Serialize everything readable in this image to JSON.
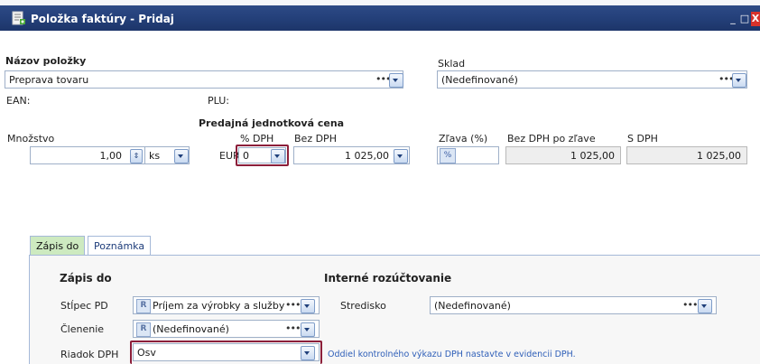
{
  "window": {
    "title": "Položka faktúry - Pridaj",
    "buttons": {
      "minimize": "_",
      "maximize": "□",
      "close": "X"
    }
  },
  "item_name": {
    "label": "Názov položky",
    "value": "Preprava tovaru"
  },
  "warehouse": {
    "label": "Sklad",
    "value": "(Nedefinované)"
  },
  "ean_label": "EAN:",
  "plu_label": "PLU:",
  "unit_price_heading": "Predajná jednotková cena",
  "quantity": {
    "label": "Množstvo",
    "value": "1,00",
    "unit": "ks"
  },
  "currency": "EUR",
  "vat_percent": {
    "label": "% DPH",
    "value": "0"
  },
  "price_excl_vat": {
    "label": "Bez DPH",
    "value": "1 025,00"
  },
  "discount": {
    "label": "Zľava (%)",
    "button": "%"
  },
  "price_after_discount": {
    "label": "Bez DPH po zľave",
    "value": "1 025,00"
  },
  "price_incl_vat": {
    "label": "S DPH",
    "value": "1 025,00"
  },
  "tabs": [
    {
      "label": "Zápis do",
      "active": true
    },
    {
      "label": "Poznámka",
      "active": false
    }
  ],
  "entry": {
    "heading": "Zápis do",
    "column_pd": {
      "label": "Stĺpec PD",
      "badge": "R",
      "value": "Príjem za výrobky a služby"
    },
    "breakdown": {
      "label": "Členenie",
      "badge": "R",
      "value": "(Nedefinované)"
    },
    "vat_row": {
      "label": "Riadok DPH",
      "value": "Osv"
    }
  },
  "internal": {
    "heading": "Interné rozúčtovanie",
    "center": {
      "label": "Stredisko",
      "value": "(Nedefinované)"
    }
  },
  "vat_note": "Oddiel kontrolného výkazu DPH nastavte v evidencii DPH.",
  "colors": {
    "titlebar": "#24407a",
    "highlight": "#8c1f3a",
    "active_tab": "#cdeac0",
    "link": "#2f5fb8"
  }
}
